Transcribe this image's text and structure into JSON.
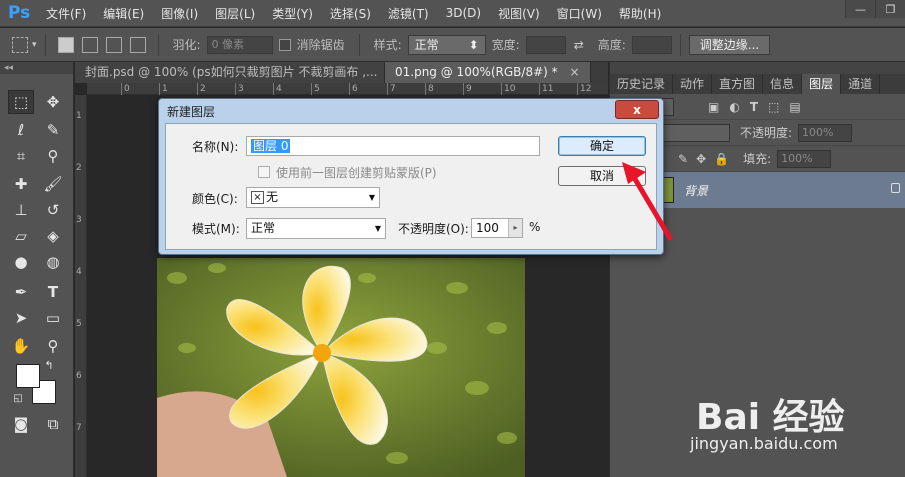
{
  "app": {
    "logo": "Ps"
  },
  "menu": [
    "文件(F)",
    "编辑(E)",
    "图像(I)",
    "图层(L)",
    "类型(Y)",
    "选择(S)",
    "滤镜(T)",
    "3D(D)",
    "视图(V)",
    "窗口(W)",
    "帮助(H)"
  ],
  "window_controls": {
    "minimize": "—",
    "restore": "❐"
  },
  "options": {
    "feather_label": "羽化:",
    "feather_value": "0 像素",
    "antialias_label": "消除锯齿",
    "style_label": "样式:",
    "style_value": "正常",
    "width_label": "宽度:",
    "height_label": "高度:",
    "refine_edge_button": "调整边缘..."
  },
  "document": {
    "tabs": [
      {
        "label": "封面.psd @ 100% (ps如何只裁剪图片 不裁剪画布 ,...",
        "close": "×"
      },
      {
        "label": "01.png @ 100%(RGB/8#) *",
        "close": "×"
      }
    ],
    "ruler_h": [
      "0",
      "1",
      "2",
      "3",
      "4",
      "5",
      "6",
      "7",
      "8",
      "9",
      "10",
      "11",
      "12"
    ],
    "ruler_v": [
      "1",
      "2",
      "3",
      "4",
      "5",
      "6",
      "7"
    ]
  },
  "panel": {
    "tabs": [
      "历史记录",
      "动作",
      "直方图",
      "信息",
      "图层",
      "通道"
    ],
    "opacity_label": "不透明度:",
    "opacity_value": "100%",
    "fill_label": "填充:",
    "fill_value": "100%",
    "layer_name": "背景"
  },
  "dialog": {
    "title": "新建图层",
    "close": "x",
    "name_label": "名称(N):",
    "name_value": "图层 0",
    "clip_label": "使用前一图层创建剪贴蒙版(P)",
    "color_label": "颜色(C):",
    "color_swatch": "×",
    "color_value": "无",
    "mode_label": "模式(M):",
    "mode_value": "正常",
    "opacity_label": "不透明度(O):",
    "opacity_value": "100",
    "opacity_unit": "%",
    "ok_button": "确定",
    "cancel_button": "取消"
  },
  "watermark": {
    "logo": "Bai 经验",
    "url": "jingyan.baidu.com"
  },
  "colors": {
    "accent": "#3aa0ff",
    "dialog_frame": "#b9d1ea",
    "close_red": "#c94b3d",
    "arrow": "#e8142a"
  },
  "icons": [
    "marquee-icon",
    "move-icon",
    "lasso-icon",
    "quick-select-icon",
    "crop-icon",
    "eyedropper-icon",
    "healing-icon",
    "brush-icon",
    "stamp-icon",
    "history-brush-icon",
    "eraser-icon",
    "bucket-icon",
    "blur-icon",
    "dodge-icon",
    "pen-icon",
    "type-icon",
    "path-select-icon",
    "rectangle-icon",
    "hand-icon",
    "zoom-icon"
  ]
}
